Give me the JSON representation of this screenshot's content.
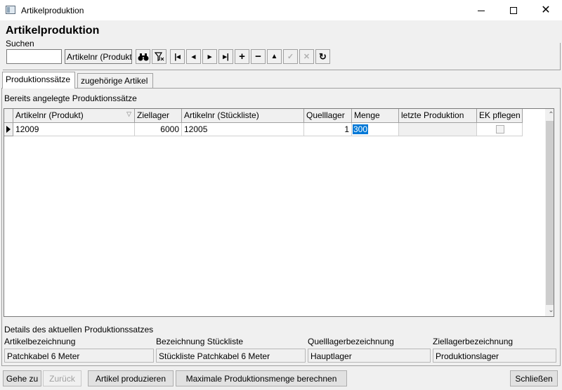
{
  "window": {
    "title": "Artikelproduktion"
  },
  "heading": "Artikelproduktion",
  "search": {
    "legend": "Suchen",
    "input_value": "",
    "field_selected": "Artikelnr (Produkt)"
  },
  "toolbar": [
    {
      "name": "find-icon",
      "glyph": "🔍"
    },
    {
      "name": "filter-icon",
      "glyph": "⊽"
    },
    {
      "name": "first-record-icon",
      "glyph": "|◄"
    },
    {
      "name": "prev-record-icon",
      "glyph": "◄"
    },
    {
      "name": "next-record-icon",
      "glyph": "►"
    },
    {
      "name": "last-record-icon",
      "glyph": "►|"
    },
    {
      "name": "add-record-icon",
      "glyph": "+"
    },
    {
      "name": "delete-record-icon",
      "glyph": "−"
    },
    {
      "name": "edit-record-icon",
      "glyph": "▲"
    },
    {
      "name": "post-record-icon",
      "glyph": "✓"
    },
    {
      "name": "cancel-record-icon",
      "glyph": "✕"
    },
    {
      "name": "refresh-icon",
      "glyph": "↻"
    }
  ],
  "tabs": [
    {
      "label": "Produktionssätze",
      "active": true
    },
    {
      "label": "zugehörige Artikel",
      "active": false
    }
  ],
  "panel_caption": "Bereits angelegte Produktionssätze",
  "grid": {
    "columns": [
      "Artikelnr (Produkt)",
      "Ziellager",
      "Artikelnr (Stückliste)",
      "Quelllager",
      "Menge",
      "letzte Produktion",
      "EK pflegen"
    ],
    "rows": [
      {
        "artikelnr_produkt": "12009",
        "ziellager": "6000",
        "artikelnr_stueckliste": "12005",
        "quelllager": "1",
        "menge": "300",
        "letzte_produktion": "",
        "ek_pflegen": false
      }
    ]
  },
  "details": {
    "caption": "Details des aktuellen Produktionssatzes",
    "artikelbezeichnung_label": "Artikelbezeichnung",
    "artikelbezeichnung_value": "Patchkabel 6 Meter",
    "stueckliste_label": "Bezeichnung Stückliste",
    "stueckliste_value": "Stückliste Patchkabel 6 Meter",
    "quelllager_label": "Quelllagerbezeichnung",
    "quelllager_value": "Hauptlager",
    "ziellager_label": "Ziellagerbezeichnung",
    "ziellager_value": "Produktionslager"
  },
  "buttons": {
    "gehe_zu": "Gehe zu",
    "zurueck": "Zurück",
    "artikel_produzieren": "Artikel produzieren",
    "max_menge": "Maximale Produktionsmenge berechnen",
    "schliessen": "Schließen"
  }
}
